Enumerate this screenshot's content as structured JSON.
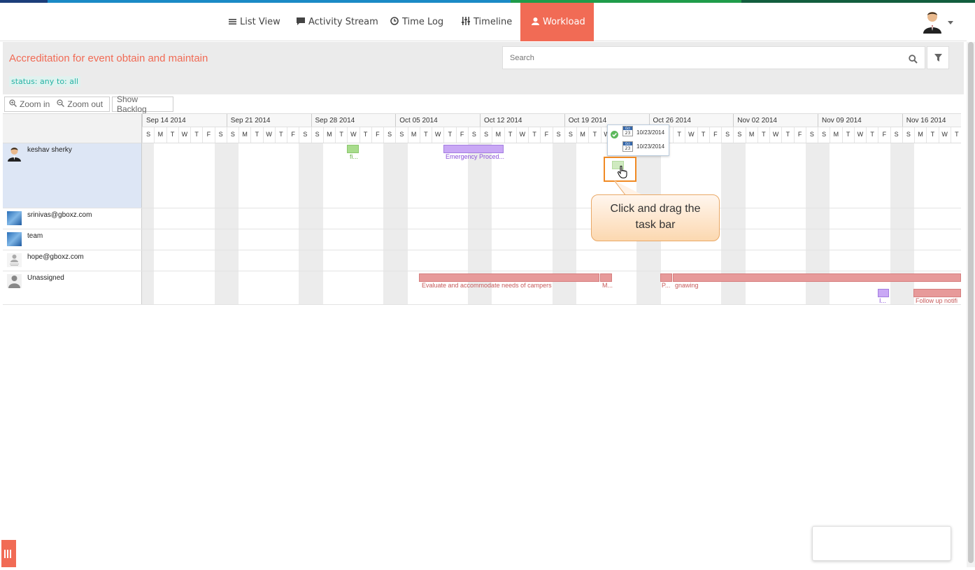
{
  "nav": {
    "tabs": [
      {
        "label": "List View",
        "icon": "list-icon"
      },
      {
        "label": "Activity Stream",
        "icon": "comment-icon"
      },
      {
        "label": "Time Log",
        "icon": "clock-icon"
      },
      {
        "label": "Timeline",
        "icon": "sliders-icon"
      },
      {
        "label": "Workload",
        "icon": "user-icon",
        "active": true
      }
    ]
  },
  "header": {
    "title": "Accreditation for event obtain and maintain",
    "filters": [
      "status: any",
      "to: all"
    ],
    "search_placeholder": "Search"
  },
  "toolbar": {
    "zoom_in": "Zoom in",
    "zoom_out": "Zoom out",
    "show_backlog": "Show Backlog"
  },
  "gantt": {
    "weeks": [
      "Sep 14 2014",
      "Sep 21 2014",
      "Sep 28 2014",
      "Oct 05 2014",
      "Oct 12 2014",
      "Oct 19 2014",
      "Oct 26 2014",
      "Nov 02 2014",
      "Nov 09 2014",
      "Nov 16 2014"
    ],
    "days": [
      "S",
      "M",
      "T",
      "W",
      "T",
      "F",
      "S"
    ],
    "resources": [
      {
        "name": "keshav sherky"
      },
      {
        "name": "srinivas@gboxz.com"
      },
      {
        "name": "team"
      },
      {
        "name": "hope@gboxz.com"
      },
      {
        "name": "Unassigned"
      }
    ],
    "bars": {
      "fi": "fi...",
      "emergency": "Emergency Proced...",
      "evaluate": "Evaluate and accommodate needs of campers",
      "m": "M...",
      "p": "P...",
      "gnawing": "gnawing",
      "i": "I...",
      "follow": "Follow up notifi"
    }
  },
  "tooltip": {
    "month": "Oct",
    "day": "23",
    "start": "10/23/2014",
    "end": "10/23/2014"
  },
  "callout": {
    "line1": "Click and drag the",
    "line2": "task bar"
  },
  "colors": {
    "accent": "#f16b55",
    "green_bar": "#a8dc8c",
    "purple_bar": "#c9a8f5",
    "red_bar": "#e79a9a",
    "teal": "#27b3a5"
  }
}
